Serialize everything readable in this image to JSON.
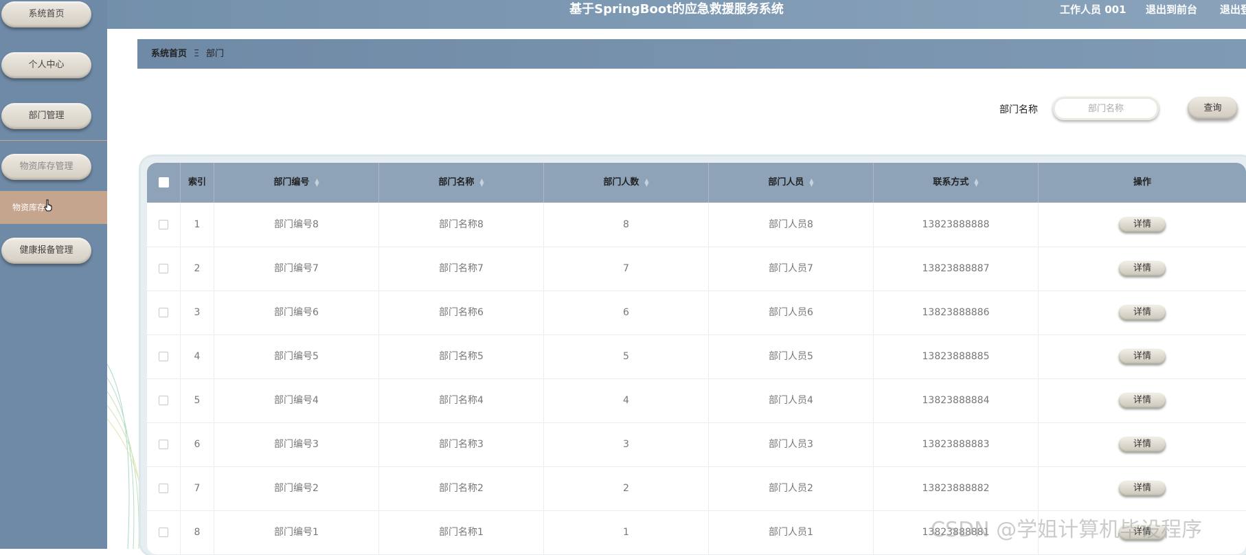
{
  "app": {
    "title": "基于SpringBoot的应急救援服务系统",
    "user_label": "工作人员 001",
    "to_frontend": "退出到前台",
    "logout": "退出登"
  },
  "sidebar": {
    "items": [
      {
        "label": "系统首页"
      },
      {
        "label": "个人中心"
      },
      {
        "label": "部门管理"
      },
      {
        "label": "物资库存管理"
      },
      {
        "label": "物资库存"
      },
      {
        "label": "健康报备管理"
      }
    ]
  },
  "breadcrumb": {
    "home": "系统首页",
    "separator": "Ξ",
    "current": "部门"
  },
  "search": {
    "label": "部门名称",
    "placeholder": "部门名称",
    "button": "查询"
  },
  "table": {
    "columns": [
      "索引",
      "部门编号",
      "部门名称",
      "部门人数",
      "部门人员",
      "联系方式",
      "操作"
    ],
    "action_label": "详情",
    "rows": [
      {
        "index": "1",
        "code": "部门编号8",
        "name": "部门名称8",
        "count": "8",
        "member": "部门人员8",
        "phone": "13823888888"
      },
      {
        "index": "2",
        "code": "部门编号7",
        "name": "部门名称7",
        "count": "7",
        "member": "部门人员7",
        "phone": "13823888887"
      },
      {
        "index": "3",
        "code": "部门编号6",
        "name": "部门名称6",
        "count": "6",
        "member": "部门人员6",
        "phone": "13823888886"
      },
      {
        "index": "4",
        "code": "部门编号5",
        "name": "部门名称5",
        "count": "5",
        "member": "部门人员5",
        "phone": "13823888885"
      },
      {
        "index": "5",
        "code": "部门编号4",
        "name": "部门名称4",
        "count": "4",
        "member": "部门人员4",
        "phone": "13823888884"
      },
      {
        "index": "6",
        "code": "部门编号3",
        "name": "部门名称3",
        "count": "3",
        "member": "部门人员3",
        "phone": "13823888883"
      },
      {
        "index": "7",
        "code": "部门编号2",
        "name": "部门名称2",
        "count": "2",
        "member": "部门人员2",
        "phone": "13823888882"
      },
      {
        "index": "8",
        "code": "部门编号1",
        "name": "部门名称1",
        "count": "1",
        "member": "部门人员1",
        "phone": "13823888881"
      }
    ]
  },
  "watermark": "CSDN @学姐计算机毕设程序",
  "colors": {
    "sidebar": "#6f8aa6",
    "active_item": "#c5a58d",
    "table_header": "#8ea3b8",
    "topbar": "#7390ab"
  }
}
